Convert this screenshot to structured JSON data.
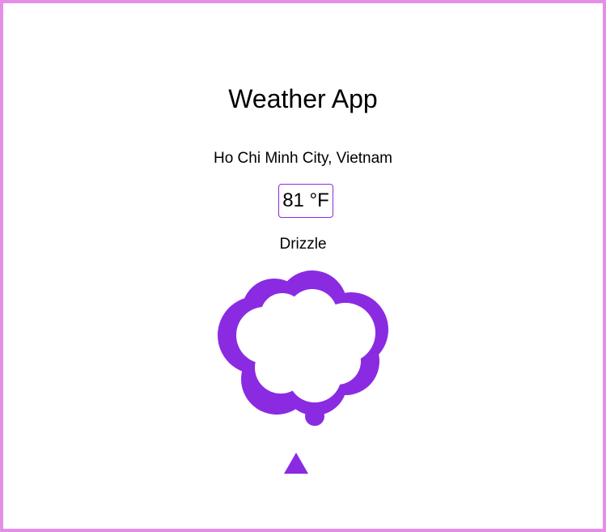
{
  "app": {
    "title": "Weather App"
  },
  "weather": {
    "location": "Ho Chi Minh City, Vietnam",
    "temperature": "81 °F",
    "condition": "Drizzle"
  },
  "icons": {
    "condition_icon": "cloud-icon",
    "precipitation_icon": "raindrop-triangle-icon"
  },
  "colors": {
    "accent": "#8a2be2",
    "frame_border": "#e48ee8",
    "background": "#ffffff",
    "text": "#000000"
  }
}
